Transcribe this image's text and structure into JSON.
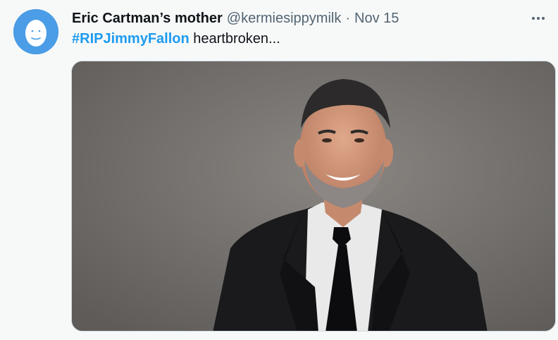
{
  "tweet": {
    "author_name": "Eric Cartman’s mother",
    "handle": "@kermiesippymilk",
    "separator": "·",
    "date": "Nov 15",
    "hashtag": "#RIPJimmyFallon",
    "text": " heartbroken...",
    "more_icon": "more-horizontal-icon",
    "avatar_icon": "egg-face-avatar",
    "media_alt": "photo-man-in-black-suit"
  },
  "colors": {
    "background": "#f7f9f9",
    "accent": "#1d9bf0",
    "text_primary": "#0f1419",
    "text_secondary": "#536471",
    "avatar_bg": "#4a9de6"
  }
}
